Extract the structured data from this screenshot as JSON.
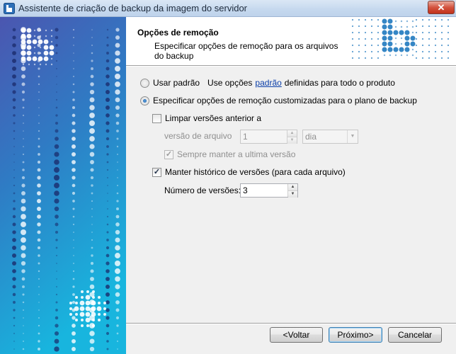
{
  "window": {
    "title": "Assistente de criação de backup da imagem do servidor",
    "close_glyph": "✕"
  },
  "header": {
    "title": "Opções de remoção",
    "subtitle": "Especificar opções de remoção para os arquivos do backup"
  },
  "options": {
    "use_default_label": "Usar padrão",
    "use_default_desc_pre": "Use opções",
    "use_default_link": "padrão",
    "use_default_desc_post": "definidas para todo o produto",
    "custom_label": "Especificar opções de remoção customizadas para o plano de backup",
    "selected": "custom"
  },
  "clean_old": {
    "label": "Limpar versões anterior a",
    "checked": false,
    "version_label": "versão de arquivo",
    "value": "1",
    "unit": "dia",
    "keep_last_label": "Sempre manter a ultima versão",
    "keep_last_checked": true
  },
  "history": {
    "label": "Manter histórico de versões (para cada arquivo)",
    "checked": true,
    "count_label": "Número de versões:",
    "count_value": "3"
  },
  "buttons": {
    "back": "<Voltar",
    "next": "Próximo>",
    "cancel": "Cancelar"
  },
  "glyphs": {
    "check": "✓",
    "up": "▲",
    "down": "▼"
  },
  "colors": {
    "banner_top": "#3e5fb0",
    "banner_bottom": "#1aa8d6",
    "dots": "#ffffff",
    "header_dots": "#2a7fc2"
  }
}
